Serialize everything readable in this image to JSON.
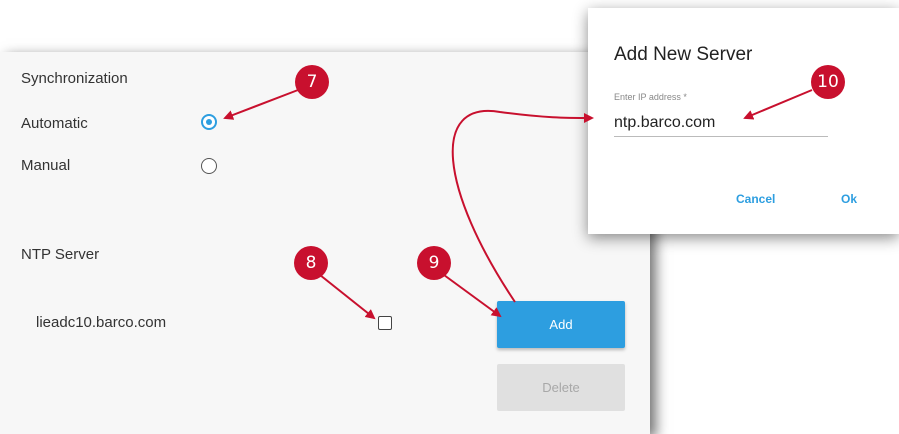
{
  "settings": {
    "sync_title": "Synchronization",
    "options": [
      {
        "label": "Automatic",
        "selected": true
      },
      {
        "label": "Manual",
        "selected": false
      }
    ],
    "ntp_title": "NTP Server",
    "servers": [
      {
        "name": "lieadc10.barco.com",
        "checked": false
      }
    ],
    "add_label": "Add",
    "delete_label": "Delete"
  },
  "dialog": {
    "title": "Add New Server",
    "field_label": "Enter IP address *",
    "field_value": "ntp.barco.com",
    "cancel_label": "Cancel",
    "ok_label": "Ok"
  },
  "callouts": [
    "7",
    "8",
    "9",
    "10"
  ],
  "colors": {
    "accent": "#2d9ee0",
    "callout": "#c8102e"
  }
}
